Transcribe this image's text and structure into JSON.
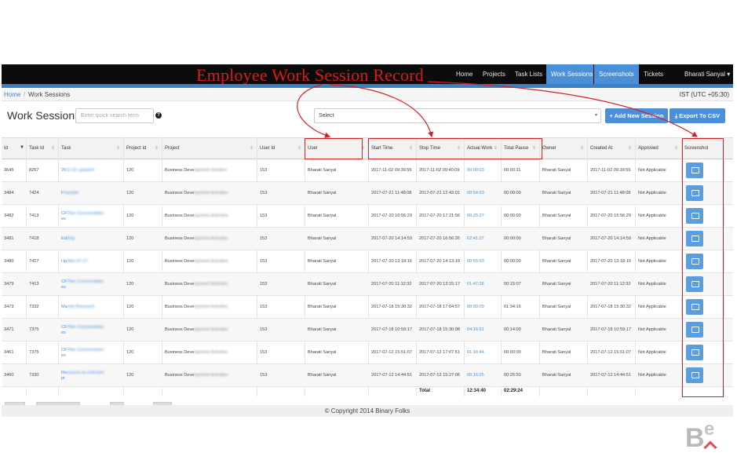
{
  "annotation": {
    "title": "Employee Work Session Record",
    "color": "#e01818"
  },
  "nav": {
    "items": [
      "Home",
      "Projects",
      "Task Lists",
      "Work Sessions",
      "Screenshots",
      "Tickets"
    ],
    "active": "Work Sessions",
    "user": "Bharati Sanyal ▾"
  },
  "breadcrumb": {
    "home": "Home",
    "separator": "/",
    "current": "Work Sessions",
    "timezone": "IST (UTC +05:30)"
  },
  "header": {
    "title": "Work Session",
    "search_placeholder": "Enter quick search term",
    "help_icon": "?",
    "select_label": "Select",
    "add_button": "+ Add New Session",
    "export_button": "⤓ Export To CSV",
    "accent_color": "#4a8fd8"
  },
  "table": {
    "headers": [
      "Id",
      "Task Id",
      "Task",
      "Project Id",
      "Project",
      "User Id",
      "User",
      "Start Time",
      "Stop Time",
      "Actual Work",
      "Total Pause",
      "Owner",
      "Created At",
      "Approved",
      "Screenshot"
    ],
    "rows": [
      {
        "id": "3645",
        "task_id": "8257",
        "task_a": "20",
        "task_b": "11-02 updated",
        "task_c": "",
        "project_id": "120",
        "project_a": "Business Deve",
        "project_b": "lopment Solution",
        "user_id": "153",
        "user": "Bharati Sanyal",
        "start": "2017-11-02 09:39:55",
        "stop": "2017-11-02 09:40:09",
        "actual": "00:00:03",
        "pause": "00:00:11",
        "owner": "Bharati Sanyal",
        "created": "2017-11-02 09:39:55",
        "approved": "Not Applicable"
      },
      {
        "id": "3484",
        "task_id": "7424",
        "task_a": "F",
        "task_b": "Sample",
        "task_c": "",
        "project_id": "120",
        "project_a": "Business Deve",
        "project_b": "lopment Activities",
        "user_id": "153",
        "user": "Bharati Sanyal",
        "start": "2017-07-21 11:48:08",
        "stop": "2017-07-21 12:43:01",
        "actual": "00:54:53",
        "pause": "00:00:00",
        "owner": "Bharati Sanyal",
        "created": "2017-07-21 11:48:08",
        "approved": "Not Applicable"
      },
      {
        "id": "3482",
        "task_id": "7413",
        "task_a": "CF",
        "task_b": "Plan Consumables",
        "task_c": "es",
        "project_id": "120",
        "project_a": "Business Deve",
        "project_b": "lopment Activities",
        "user_id": "153",
        "user": "Bharati Sanyal",
        "start": "2017-07-20 16:56:29",
        "stop": "2017-07-20 17:21:56",
        "actual": "00:25:27",
        "pause": "00:00:00",
        "owner": "Bharati Sanyal",
        "created": "2017-07-20 16:56:29",
        "approved": "Not Applicable"
      },
      {
        "id": "3481",
        "task_id": "7418",
        "task_a": "Ed",
        "task_b": "iting",
        "task_c": "",
        "project_id": "120",
        "project_a": "Business Deve",
        "project_b": "lopment Activities",
        "user_id": "153",
        "user": "Bharati Sanyal",
        "start": "2017-07-20 14:14:59",
        "stop": "2017-07-20 16:56:26",
        "actual": "02:41:27",
        "pause": "00:00:00",
        "owner": "Bharati Sanyal",
        "created": "2017-07-20 14:14:59",
        "approved": "Not Applicable"
      },
      {
        "id": "3480",
        "task_id": "7417",
        "task_a": "Up",
        "task_b": "date 07-17",
        "task_c": "",
        "project_id": "120",
        "project_a": "Business Deve",
        "project_b": "lopment Activities",
        "user_id": "153",
        "user": "Bharati Sanyal",
        "start": "2017-07-20 13:18:16",
        "stop": "2017-07-20 14:13:19",
        "actual": "00:55:03",
        "pause": "00:00:00",
        "owner": "Bharati Sanyal",
        "created": "2017-07-20 13:18:16",
        "approved": "Not Applicable"
      },
      {
        "id": "3479",
        "task_id": "7413",
        "task_a": "CF",
        "task_b": "Plan Consumables",
        "task_c": "es",
        "project_id": "120",
        "project_a": "Business Deve",
        "project_b": "lopment Activities",
        "user_id": "153",
        "user": "Bharati Sanyal",
        "start": "2017-07-20 11:12:32",
        "stop": "2017-07-20 13:15:17",
        "actual": "01:47:38",
        "pause": "00:15:07",
        "owner": "Bharati Sanyal",
        "created": "2017-07-20 11:12:32",
        "approved": "Not Applicable"
      },
      {
        "id": "3473",
        "task_id": "7332",
        "task_a": "Ma",
        "task_b": "rket Research",
        "task_c": "",
        "project_id": "120",
        "project_a": "Business Deve",
        "project_b": "lopment Activities",
        "user_id": "153",
        "user": "Bharati Sanyal",
        "start": "2017-07-18 15:30:32",
        "stop": "2017-07-18 17:04:57",
        "actual": "00:00:09",
        "pause": "01:34:16",
        "owner": "Bharati Sanyal",
        "created": "2017-07-18 15:30:32",
        "approved": "Not Applicable"
      },
      {
        "id": "3471",
        "task_id": "7375",
        "task_a": "CF",
        "task_b": "Plan Consumables",
        "task_c": "es",
        "project_id": "120",
        "project_a": "Business Deve",
        "project_b": "lopment Activities",
        "user_id": "153",
        "user": "Bharati Sanyal",
        "start": "2017-07-18 10:59:17",
        "stop": "2017-07-18 15:30:08",
        "actual": "04:16:51",
        "pause": "00:14:00",
        "owner": "Bharati Sanyal",
        "created": "2017-07-18 10:59:17",
        "approved": "Not Applicable"
      },
      {
        "id": "3461",
        "task_id": "7375",
        "task_a": "CF",
        "task_b": "Plan Consumables",
        "task_c": "es",
        "project_id": "120",
        "project_a": "Business Deve",
        "project_b": "lopment Activities",
        "user_id": "153",
        "user": "Bharati Sanyal",
        "start": "2017-07-12 15:51:07",
        "stop": "2017-07-12 17:07:51",
        "actual": "01:16:44",
        "pause": "00:00:00",
        "owner": "Bharati Sanyal",
        "created": "2017-07-12 15:51:07",
        "approved": "Not Applicable"
      },
      {
        "id": "3460",
        "task_id": "7330",
        "task_a": "Re",
        "task_b": "search on selected",
        "task_c": "pr",
        "project_id": "120",
        "project_a": "Business Deve",
        "project_b": "lopment Activities",
        "user_id": "153",
        "user": "Bharati Sanyal",
        "start": "2017-07-12 14:44:51",
        "stop": "2017-07-12 15:27:06",
        "actual": "00:16:25",
        "pause": "00:25:50",
        "owner": "Bharati Sanyal",
        "created": "2017-07-12 14:44:51",
        "approved": "Not Applicable"
      }
    ],
    "totals": {
      "label": "Total",
      "actual": "12:34:40",
      "pause": "02:29:24"
    }
  },
  "footer": {
    "copyright": "© Copyright 2014 Binary Folks"
  },
  "watermark": {
    "text": "Be"
  }
}
